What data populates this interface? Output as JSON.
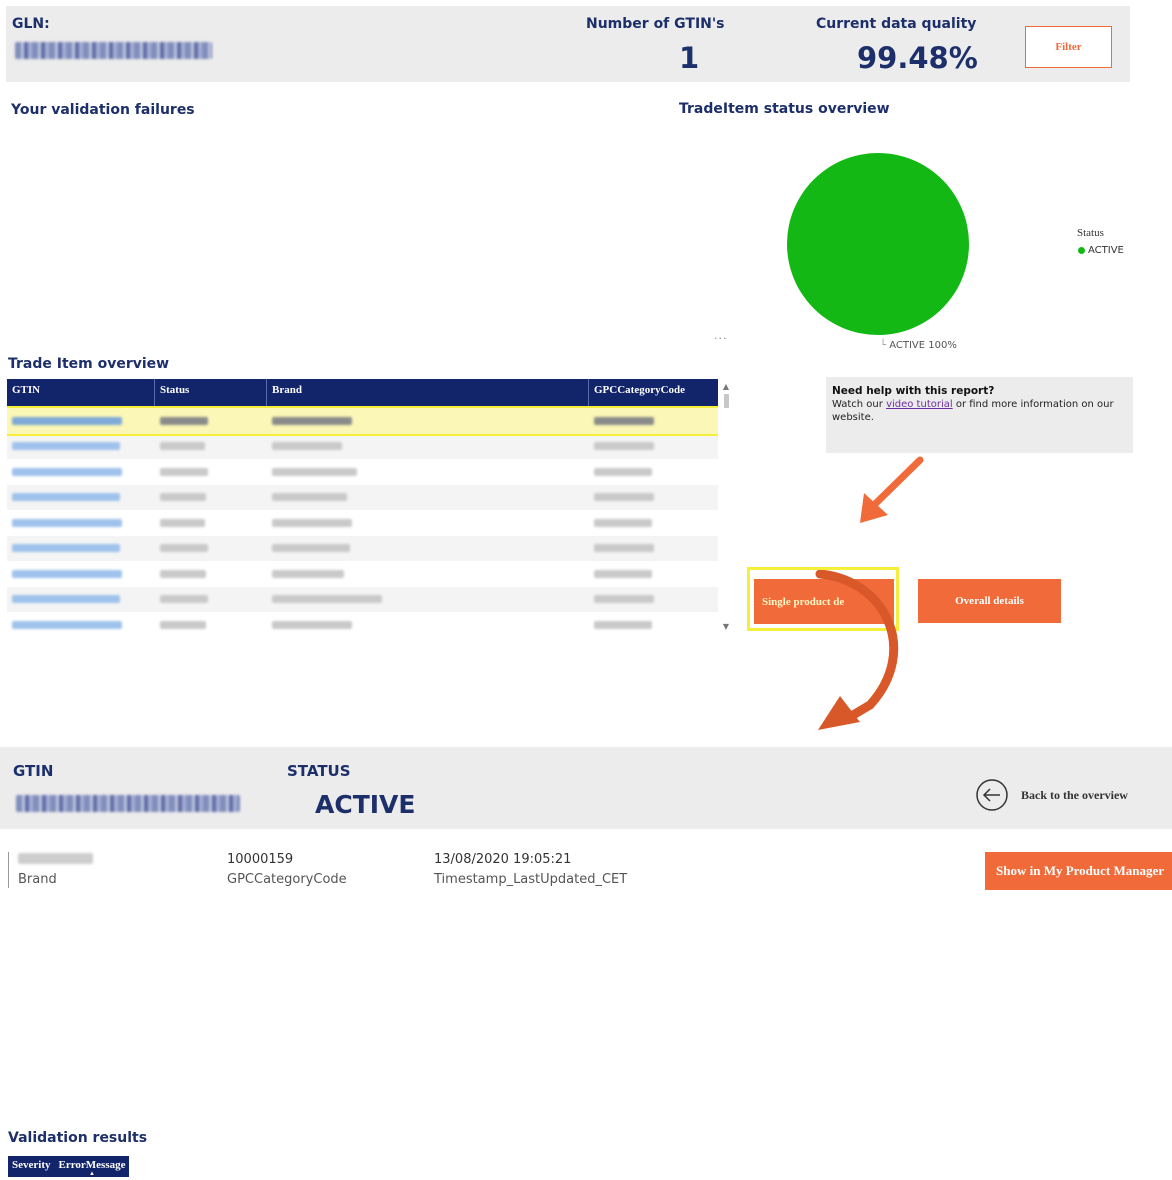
{
  "header": {
    "gln_label": "GLN:",
    "gtin_count_label": "Number of GTIN's",
    "gtin_count_value": "1",
    "quality_label": "Current data quality",
    "quality_value": "99.48%",
    "filter_label": "Filter"
  },
  "sections": {
    "validation_failures_title": "Your validation failures",
    "status_overview_title": "TradeItem status overview",
    "trade_item_overview_title": "Trade Item overview",
    "validation_results_title": "Validation results"
  },
  "pie": {
    "legend_title": "Status",
    "slices": [
      {
        "label": "ACTIVE",
        "value": 100,
        "color": "#14b814"
      }
    ],
    "data_label": "ACTIVE 100%"
  },
  "trade_table": {
    "columns": [
      "GTIN",
      "Status",
      "Brand",
      "GPCCategoryCode"
    ],
    "selected_row": 0
  },
  "help": {
    "title": "Need help with this report?",
    "text_before": "Watch our ",
    "link": "video tutorial",
    "text_after": " or find more information on our website."
  },
  "buttons": {
    "single_product": "Single product de",
    "overall_details": "Overall details",
    "show_in_pm": "Show in My Product Manager",
    "back": "Back to the overview"
  },
  "detail": {
    "gtin_label": "GTIN",
    "status_label": "STATUS",
    "status_value": "ACTIVE",
    "brand_label": "Brand",
    "gpc_value": "10000159",
    "gpc_label": "GPCCategoryCode",
    "timestamp_value": "13/08/2020 19:05:21",
    "timestamp_label": "Timestamp_LastUpdated_CET"
  },
  "validation_table": {
    "columns": [
      "Severity",
      "ErrorMessage"
    ]
  },
  "colors": {
    "navy": "#12246a",
    "accent_orange": "#f06a3a",
    "highlight_yellow": "#f5ef3a",
    "active_green": "#14b814"
  }
}
